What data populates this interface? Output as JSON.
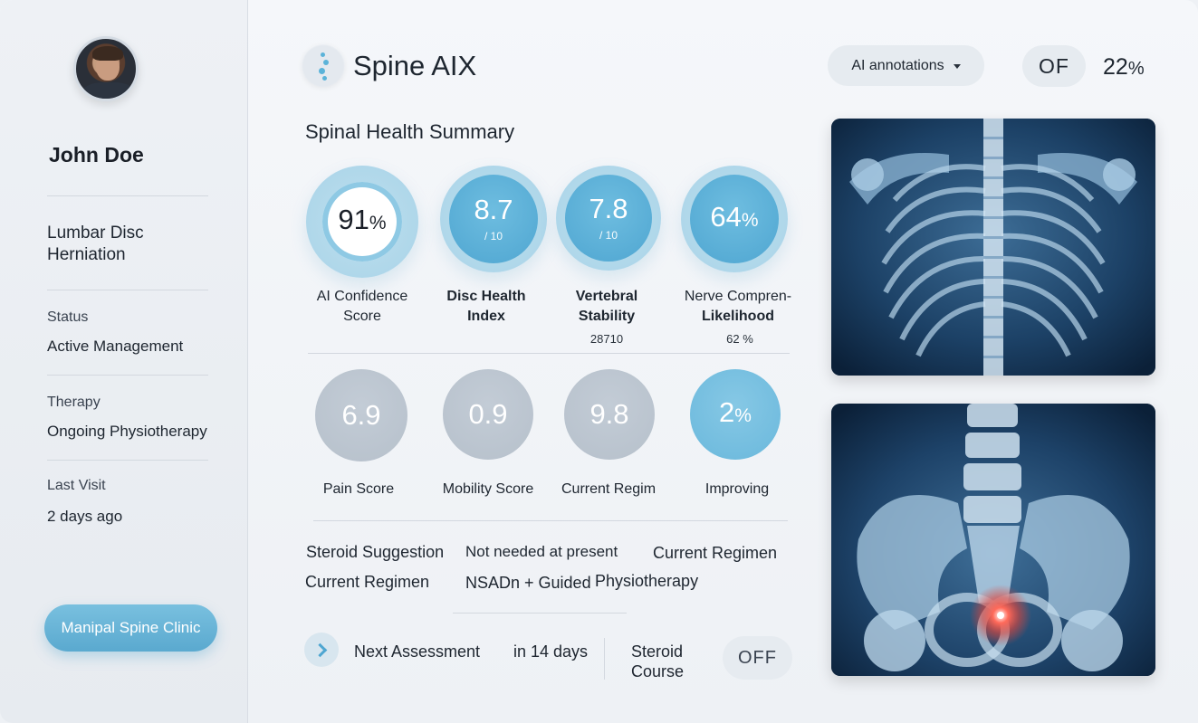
{
  "sidebar": {
    "patient_name": "John Doe",
    "diagnosis_line1": "Lumbar Disc",
    "diagnosis_line2": "Herniation",
    "status_label": "Status",
    "status_value": "Active Management",
    "therapy_label": "Therapy",
    "therapy_value": "Ongoing Physiotherapy",
    "last_visit_label": "Last Visit",
    "last_visit_value": "2 days ago",
    "clinic_button": "Manipal Spine Clinic"
  },
  "header": {
    "app_title": "Spine AIX",
    "annotations_dropdown": "AI annotations",
    "of_toggle": "OF",
    "percent_value": "22",
    "percent_unit": "%"
  },
  "summary": {
    "title": "Spinal Health Summary",
    "top_metrics": [
      {
        "value": "91",
        "unit": "%",
        "sub": "",
        "label_line1": "AI Confidence",
        "label_line2": "Score",
        "extra": ""
      },
      {
        "value": "8.7",
        "unit": "",
        "sub": "/ 10",
        "label_line1": "Disc Health",
        "label_line2": "Index",
        "extra": ""
      },
      {
        "value": "7.8",
        "unit": "",
        "sub": "/ 10",
        "label_line1": "Vertebral",
        "label_line2": "Stability",
        "extra": "28710"
      },
      {
        "value": "64",
        "unit": "%",
        "sub": "",
        "label_line1": "Nerve Compren-",
        "label_line2": "Likelihood",
        "extra": "62 %"
      }
    ],
    "bottom_metrics": [
      {
        "value": "6.9",
        "unit": "",
        "label": "Pain Score"
      },
      {
        "value": "0.9",
        "unit": "",
        "label": "Mobility Score"
      },
      {
        "value": "9.8",
        "unit": "",
        "label": "Current Regim"
      },
      {
        "value": "2",
        "unit": "%",
        "label": "Improving"
      }
    ]
  },
  "suggestions": {
    "steroid_label": "Steroid Suggestion",
    "steroid_value": "Not needed at present",
    "regimen_header": "Current Regimen",
    "regimen_label": "Current Regimen",
    "regimen_value1": "NSADn + Guided",
    "regimen_value2": "Physiotherapy"
  },
  "footer": {
    "next_assessment_label": "Next Assessment",
    "next_assessment_value": "in 14 days",
    "steroid_course_line1": "Steroid",
    "steroid_course_line2": "Course",
    "off_toggle": "OFF"
  },
  "colors": {
    "accent": "#5aa9cf",
    "accent_light": "#a8d3e8",
    "grey_metric": "#b6c0cb",
    "background": "#eef1f5"
  }
}
